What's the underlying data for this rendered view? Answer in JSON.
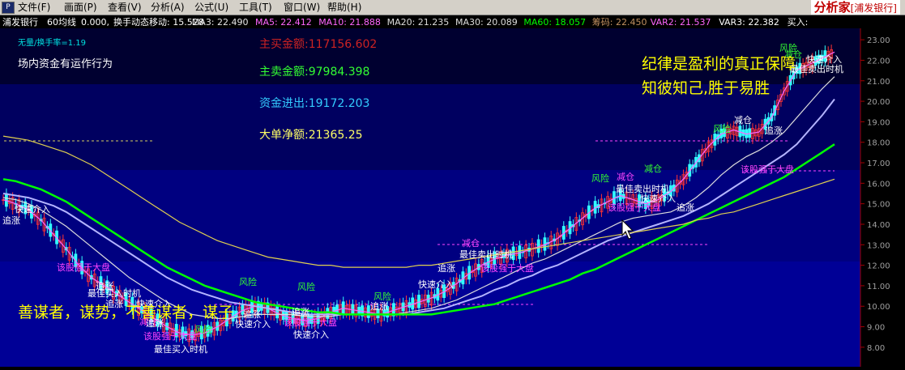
{
  "menubar": {
    "logo_icon": "app-logo-icon",
    "items": [
      "文件(F)",
      "画面(P)",
      "查看(V)",
      "分析(A)",
      "公式(U)",
      "工具(T)",
      "窗口(W)",
      "帮助(H)"
    ],
    "app_name": "分析家",
    "app_sub": "[浦发银行]"
  },
  "header": {
    "stock_name": "浦发银行",
    "period": "60均线",
    "first_value": "0.000,",
    "indicators": [
      {
        "label": "换手动态移动: 15.528",
        "color": "#ffffff"
      },
      {
        "label": "MA3: 22.490",
        "color": "#e6e6e6"
      },
      {
        "label": "MA5: 22.412",
        "color": "#ff66ff"
      },
      {
        "label": "MA10: 21.888",
        "color": "#ff66ff"
      },
      {
        "label": "MA20: 21.235",
        "color": "#dcdcdc"
      },
      {
        "label": "MA30: 20.089",
        "color": "#dcdcdc"
      },
      {
        "label": "MA60: 18.057",
        "color": "#00ff00"
      },
      {
        "label": "筹码: 22.450",
        "color": "#c09060"
      },
      {
        "label": "VAR2: 21.537",
        "color": "#ff66ff"
      },
      {
        "label": "VAR3: 22.382",
        "color": "#ffffff"
      },
      {
        "label": "买入:",
        "color": "#ffffff"
      }
    ]
  },
  "info": {
    "turnover": "无量/换手率=1.19",
    "fund_note": "场内资金有运作行为",
    "buy_amount": "主买金额:117156.602",
    "sell_amount": "主卖金额:97984.398",
    "fund_flow": "资金进出:19172.203",
    "big_order": "大单净额:21365.25"
  },
  "slogans": {
    "line1": "纪律是盈利的真正保障",
    "line2": "知彼知己,胜于易胜",
    "line3": "善谋者，谋势，不善谋者，谋子"
  },
  "price_axis": {
    "ticks": [
      "23.00",
      "22.00",
      "21.00",
      "20.00",
      "19.00",
      "18.00",
      "17.00",
      "16.00",
      "15.00",
      "14.00",
      "13.00",
      "12.00",
      "11.00",
      "10.00",
      "9.00",
      "8.00"
    ]
  },
  "signals": [
    {
      "text": "追涨",
      "color": "#ffffff"
    },
    {
      "text": "快速介入",
      "color": "#ffffff"
    },
    {
      "text": "该股强于大盘",
      "color": "#ff44ff"
    },
    {
      "text": "追涨",
      "color": "#ffffff"
    },
    {
      "text": "最佳买入时机",
      "color": "#ffffff"
    },
    {
      "text": "追涨",
      "color": "#ffffff"
    },
    {
      "text": "快速介入",
      "color": "#ffffff"
    },
    {
      "text": "减仓",
      "color": "#ff44ff"
    },
    {
      "text": "追涨",
      "color": "#ffffff"
    },
    {
      "text": "该股强于大盘",
      "color": "#ff44ff"
    },
    {
      "text": "风险",
      "color": "#33ff33"
    },
    {
      "text": "最佳买入时机",
      "color": "#ffffff"
    },
    {
      "text": "风险",
      "color": "#33ff33"
    },
    {
      "text": "追涨",
      "color": "#ffffff"
    },
    {
      "text": "快速介入",
      "color": "#ffffff"
    },
    {
      "text": "该股强于大盘",
      "color": "#ff44ff"
    },
    {
      "text": "风险",
      "color": "#33ff33"
    },
    {
      "text": "追涨",
      "color": "#ffffff"
    },
    {
      "text": "快速介入",
      "color": "#ffffff"
    },
    {
      "text": "风险",
      "color": "#33ff33"
    },
    {
      "text": "追涨",
      "color": "#ffffff"
    },
    {
      "text": "最佳卖出时机",
      "color": "#ffffff"
    },
    {
      "text": "减仓",
      "color": "#ff44ff"
    },
    {
      "text": "该股强于大盘",
      "color": "#ff44ff"
    },
    {
      "text": "追涨",
      "color": "#ffffff"
    },
    {
      "text": "快速介入",
      "color": "#ffffff"
    },
    {
      "text": "风险",
      "color": "#33ff33"
    },
    {
      "text": "减仓",
      "color": "#ff44ff"
    },
    {
      "text": "最佳卖出时机",
      "color": "#ffffff"
    },
    {
      "text": "快速介入",
      "color": "#ffffff"
    },
    {
      "text": "该股强于大盘",
      "color": "#ff44ff"
    },
    {
      "text": "追涨",
      "color": "#ffffff"
    },
    {
      "text": "减仓",
      "color": "#33ff33"
    },
    {
      "text": "该股强于大盘",
      "color": "#ff44ff"
    },
    {
      "text": "风险",
      "color": "#33ff33"
    },
    {
      "text": "减仓",
      "color": "#ffffff"
    },
    {
      "text": "追涨",
      "color": "#ffffff"
    },
    {
      "text": "风险",
      "color": "#33ff33"
    },
    {
      "text": "减仓",
      "color": "#33ff33"
    },
    {
      "text": "最佳卖出时机",
      "color": "#ffffff"
    },
    {
      "text": "快速介入",
      "color": "#ffffff"
    }
  ],
  "chart_data": {
    "type": "line",
    "ylim": [
      7.6,
      23.4
    ],
    "grid": false,
    "background_bands": [
      "#000033",
      "#000066",
      "#00008a"
    ],
    "series": [
      {
        "name": "MA5",
        "color": "#ff66ff",
        "values": [
          15.2,
          15.0,
          14.7,
          14.2,
          13.5,
          12.8,
          12.0,
          11.4,
          11.0,
          10.6,
          10.2,
          9.8,
          9.4,
          9.0,
          8.7,
          8.6,
          8.7,
          9.0,
          9.4,
          9.8,
          10.0,
          9.9,
          9.6,
          9.4,
          9.3,
          9.4,
          9.7,
          9.9,
          9.8,
          9.7,
          9.6,
          9.8,
          10.0,
          10.2,
          10.4,
          10.7,
          11.1,
          11.6,
          12.0,
          12.3,
          12.5,
          12.6,
          12.8,
          13.0,
          13.3,
          13.8,
          14.3,
          14.8,
          15.1,
          15.4,
          15.2,
          15.0,
          15.2,
          15.6,
          16.2,
          17.0,
          17.8,
          18.4,
          18.6,
          18.4,
          18.5,
          19.2,
          20.5,
          21.5,
          21.8,
          22.1,
          22.4
        ]
      },
      {
        "name": "MA20",
        "color": "#dcdcdc",
        "values": [
          15.3,
          15.2,
          15.0,
          14.7,
          14.3,
          13.9,
          13.4,
          12.9,
          12.4,
          11.9,
          11.4,
          11.0,
          10.6,
          10.2,
          9.9,
          9.6,
          9.5,
          9.4,
          9.4,
          9.5,
          9.6,
          9.6,
          9.6,
          9.6,
          9.5,
          9.5,
          9.5,
          9.6,
          9.6,
          9.6,
          9.6,
          9.6,
          9.7,
          9.8,
          9.9,
          10.1,
          10.3,
          10.6,
          10.9,
          11.2,
          11.5,
          11.8,
          12.1,
          12.3,
          12.6,
          12.9,
          13.2,
          13.5,
          13.8,
          14.1,
          14.3,
          14.4,
          14.5,
          14.6,
          14.9,
          15.3,
          15.8,
          16.4,
          16.9,
          17.3,
          17.6,
          18.0,
          18.5,
          19.2,
          19.9,
          20.6,
          21.2
        ]
      },
      {
        "name": "MA30",
        "color": "#b4b4ff",
        "values": [
          15.5,
          15.4,
          15.3,
          15.1,
          14.9,
          14.6,
          14.2,
          13.8,
          13.4,
          13.0,
          12.6,
          12.2,
          11.8,
          11.4,
          11.1,
          10.8,
          10.6,
          10.4,
          10.2,
          10.1,
          10.0,
          9.9,
          9.8,
          9.7,
          9.6,
          9.6,
          9.6,
          9.6,
          9.6,
          9.6,
          9.6,
          9.6,
          9.6,
          9.7,
          9.8,
          9.9,
          10.1,
          10.3,
          10.5,
          10.8,
          11.0,
          11.3,
          11.5,
          11.8,
          12.0,
          12.3,
          12.6,
          12.9,
          13.2,
          13.4,
          13.6,
          13.8,
          14.0,
          14.2,
          14.4,
          14.7,
          15.0,
          15.4,
          15.8,
          16.2,
          16.6,
          17.0,
          17.4,
          17.9,
          18.6,
          19.3,
          20.1
        ]
      },
      {
        "name": "MA60",
        "color": "#00ff00",
        "values": [
          16.2,
          16.1,
          15.9,
          15.7,
          15.4,
          15.1,
          14.7,
          14.3,
          13.9,
          13.5,
          13.1,
          12.7,
          12.3,
          11.9,
          11.6,
          11.3,
          11.0,
          10.8,
          10.6,
          10.4,
          10.2,
          10.1,
          10.0,
          9.9,
          9.8,
          9.7,
          9.7,
          9.6,
          9.6,
          9.6,
          9.6,
          9.6,
          9.6,
          9.6,
          9.6,
          9.7,
          9.8,
          9.9,
          10.0,
          10.1,
          10.3,
          10.5,
          10.7,
          10.9,
          11.1,
          11.3,
          11.6,
          11.8,
          12.1,
          12.4,
          12.7,
          13.0,
          13.3,
          13.6,
          13.9,
          14.2,
          14.5,
          14.8,
          15.1,
          15.4,
          15.7,
          16.0,
          16.3,
          16.7,
          17.1,
          17.5,
          17.9
        ]
      },
      {
        "name": "筹码",
        "color": "#e0d050",
        "values": [
          18.3,
          18.2,
          18.1,
          17.9,
          17.7,
          17.5,
          17.2,
          16.9,
          16.5,
          16.1,
          15.7,
          15.3,
          14.9,
          14.5,
          14.1,
          13.8,
          13.5,
          13.2,
          13.0,
          12.8,
          12.6,
          12.4,
          12.3,
          12.2,
          12.1,
          12.0,
          12.0,
          11.9,
          11.9,
          11.9,
          11.9,
          11.9,
          11.9,
          12.0,
          12.0,
          12.1,
          12.2,
          12.3,
          12.4,
          12.5,
          12.6,
          12.7,
          12.8,
          12.9,
          13.0,
          13.1,
          13.2,
          13.3,
          13.4,
          13.5,
          13.6,
          13.7,
          13.8,
          13.9,
          14.0,
          14.2,
          14.3,
          14.5,
          14.6,
          14.8,
          15.0,
          15.2,
          15.4,
          15.6,
          15.8,
          16.0,
          16.2
        ]
      }
    ]
  }
}
